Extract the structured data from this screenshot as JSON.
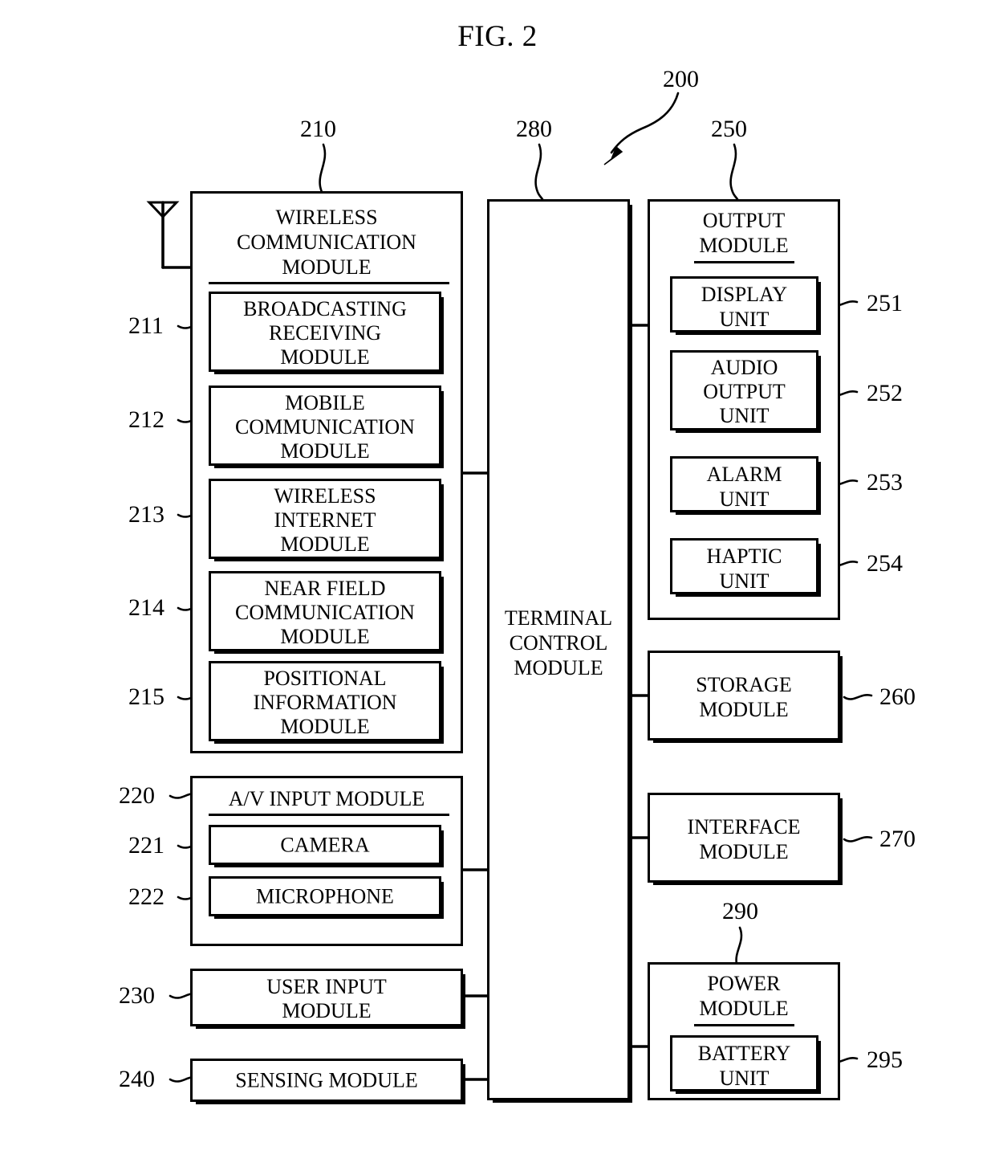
{
  "figure": {
    "title": "FIG. 2",
    "overall_ref": "200"
  },
  "refs": {
    "wireless_communication_module": "210",
    "broadcasting_receiving_module": "211",
    "mobile_communication_module": "212",
    "wireless_internet_module": "213",
    "near_field_communication_module": "214",
    "positional_information_module": "215",
    "av_input_module": "220",
    "camera": "221",
    "microphone": "222",
    "user_input_module": "230",
    "sensing_module": "240",
    "output_module": "250",
    "display_unit": "251",
    "audio_output_unit": "252",
    "alarm_unit": "253",
    "haptic_unit": "254",
    "storage_module": "260",
    "interface_module": "270",
    "terminal_control_module": "280",
    "power_module": "290",
    "battery_unit": "295"
  },
  "blocks": {
    "wireless_communication_module": {
      "title_line1": "WIRELESS",
      "title_line2": "COMMUNICATION",
      "title_line3": "MODULE",
      "children": [
        {
          "line1": "BROADCASTING",
          "line2": "RECEIVING",
          "line3": "MODULE"
        },
        {
          "line1": "MOBILE",
          "line2": "COMMUNICATION",
          "line3": "MODULE"
        },
        {
          "line1": "WIRELESS",
          "line2": "INTERNET",
          "line3": "MODULE"
        },
        {
          "line1": "NEAR FIELD",
          "line2": "COMMUNICATION",
          "line3": "MODULE"
        },
        {
          "line1": "POSITIONAL",
          "line2": "INFORMATION",
          "line3": "MODULE"
        }
      ]
    },
    "av_input_module": {
      "title": "A/V INPUT MODULE",
      "children": [
        {
          "label": "CAMERA"
        },
        {
          "label": "MICROPHONE"
        }
      ]
    },
    "user_input_module": {
      "line1": "USER INPUT",
      "line2": "MODULE"
    },
    "sensing_module": {
      "line1": "SENSING MODULE"
    },
    "terminal_control_module": {
      "line1": "TERMINAL",
      "line2": "CONTROL",
      "line3": "MODULE"
    },
    "output_module": {
      "title_line1": "OUTPUT",
      "title_line2": "MODULE",
      "children": [
        {
          "line1": "DISPLAY",
          "line2": "UNIT"
        },
        {
          "line1": "AUDIO",
          "line2": "OUTPUT",
          "line3": "UNIT"
        },
        {
          "line1": "ALARM",
          "line2": "UNIT"
        },
        {
          "line1": "HAPTIC",
          "line2": "UNIT"
        }
      ]
    },
    "storage_module": {
      "line1": "STORAGE",
      "line2": "MODULE"
    },
    "interface_module": {
      "line1": "INTERFACE",
      "line2": "MODULE"
    },
    "power_module": {
      "title_line1": "POWER",
      "title_line2": "MODULE",
      "children": [
        {
          "line1": "BATTERY",
          "line2": "UNIT"
        }
      ]
    }
  },
  "icons": {
    "antenna": "antenna-icon",
    "pointer_arrow": "arrow-pointer-icon"
  },
  "colors": {
    "stroke": "#000000",
    "background": "#ffffff"
  }
}
